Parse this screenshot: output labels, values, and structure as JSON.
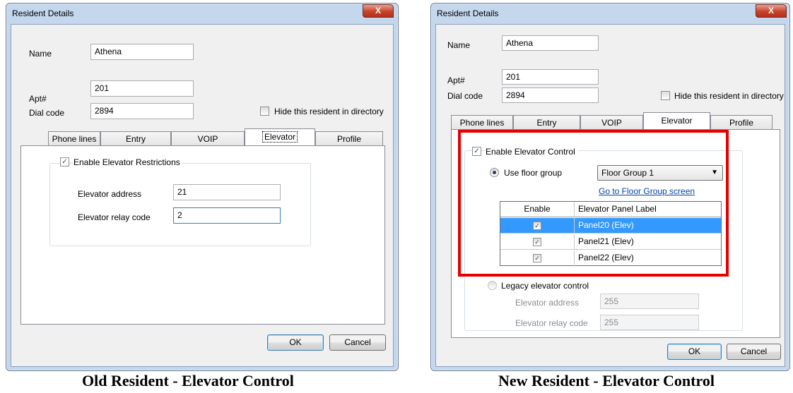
{
  "left_dialog": {
    "title": "Resident Details",
    "close_label": "X",
    "name_label": "Name",
    "name_value": "Athena",
    "apt_label": "Apt#",
    "apt_value": "201",
    "dial_label": "Dial code",
    "dial_value": "2894",
    "hide_label": "Hide this resident in directory",
    "tabs": [
      "Phone lines",
      "Entry",
      "VOIP",
      "Elevator",
      "Profile"
    ],
    "enable_label": "Enable Elevator Restrictions",
    "enable_check": "✓",
    "elev_address_label": "Elevator address",
    "elev_address_value": "21",
    "elev_relay_label": "Elevator relay code",
    "elev_relay_value": "2",
    "ok_label": "OK",
    "cancel_label": "Cancel"
  },
  "right_dialog": {
    "title": "Resident Details",
    "close_label": "X",
    "name_label": "Name",
    "name_value": "Athena",
    "apt_label": "Apt#",
    "apt_value": "201",
    "dial_label": "Dial code",
    "dial_value": "2894",
    "hide_label": "Hide this resident in directory",
    "tabs": [
      "Phone lines",
      "Entry",
      "VOIP",
      "Elevator",
      "Profile"
    ],
    "enable_label": "Enable Elevator Control",
    "enable_check": "✓",
    "use_floor_group_label": "Use floor group",
    "floor_group_value": "Floor Group 1",
    "floor_group_arrow": "▼",
    "go_to_link": "Go to Floor Group screen",
    "grid_headers": [
      "Enable",
      "Elevator Panel Label"
    ],
    "grid_rows": [
      {
        "check": "✓",
        "label": "Panel20 (Elev)"
      },
      {
        "check": "✓",
        "label": "Panel21 (Elev)"
      },
      {
        "check": "✓",
        "label": "Panel22 (Elev)"
      }
    ],
    "legacy_label": "Legacy elevator control",
    "elev_address_label": "Elevator address",
    "elev_address_value": "255",
    "elev_relay_label": "Elevator relay code",
    "elev_relay_value": "255",
    "ok_label": "OK",
    "cancel_label": "Cancel"
  },
  "captions": {
    "left": "Old Resident - Elevator Control",
    "right": "New Resident - Elevator Control"
  },
  "colors": {
    "highlight": "#e60000",
    "selection": "#3399ff"
  }
}
